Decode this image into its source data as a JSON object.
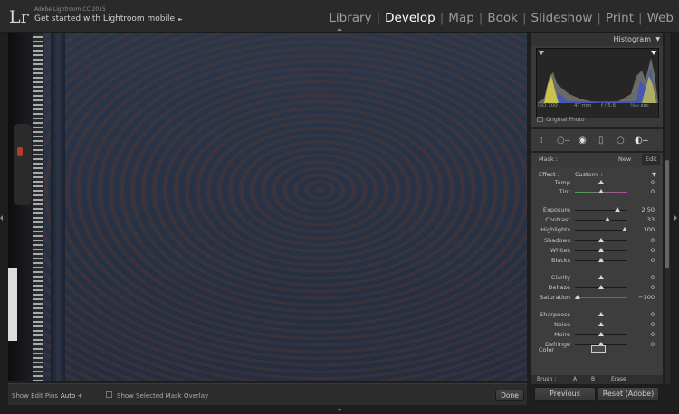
{
  "header": {
    "logo": "Lr",
    "app_name": "Adobe Lightroom CC 2015",
    "mobile_link": "Get started with Lightroom mobile",
    "mobile_arrow": "►",
    "modules": [
      "Library",
      "Develop",
      "Map",
      "Book",
      "Slideshow",
      "Print",
      "Web"
    ],
    "active_module": "Develop",
    "separator": "|"
  },
  "toolbar": {
    "edit_pins_label": "Show Edit Pins :",
    "edit_pins_value": "Auto ÷",
    "mask_overlay_label": "Show Selected Mask Overlay",
    "mask_overlay_checked": false,
    "done_label": "Done"
  },
  "histogram": {
    "title": "Histogram",
    "collapse_icon": "▼",
    "iso": "ISO 100",
    "focal": "47 mm",
    "aperture": "f / 5.6",
    "shutter": "¹⁄₂₀₀ sec",
    "original_photo_label": "Original Photo"
  },
  "tools": [
    "crop-overlay",
    "spot-removal",
    "red-eye",
    "graduated-filter",
    "radial-filter",
    "adjustment-brush"
  ],
  "mask": {
    "label": "Mask :",
    "new_label": "New",
    "edit_label": "Edit"
  },
  "effect": {
    "label": "Effect :",
    "value": "Custom ÷",
    "collapse": "▼"
  },
  "sliders": [
    {
      "label": "Temp",
      "value": "0",
      "position": 0.5
    },
    {
      "label": "Tint",
      "value": "0",
      "position": 0.5
    },
    {
      "label": "Exposure",
      "value": "2.50",
      "position": 0.81
    },
    {
      "label": "Contrast",
      "value": "33",
      "position": 0.62
    },
    {
      "label": "Highlights",
      "value": "100",
      "position": 0.95
    },
    {
      "label": "Shadows",
      "value": "0",
      "position": 0.5
    },
    {
      "label": "Whites",
      "value": "0",
      "position": 0.5
    },
    {
      "label": "Blacks",
      "value": "0",
      "position": 0.5
    },
    {
      "label": "Clarity",
      "value": "0",
      "position": 0.5
    },
    {
      "label": "Dehaze",
      "value": "0",
      "position": 0.5
    },
    {
      "label": "Saturation",
      "value": "−100",
      "position": 0.05
    },
    {
      "label": "Sharpness",
      "value": "0",
      "position": 0.5
    },
    {
      "label": "Noise",
      "value": "0",
      "position": 0.5
    },
    {
      "label": "Moiré",
      "value": "0",
      "position": 0.5
    },
    {
      "label": "Defringe",
      "value": "0",
      "position": 0.5
    }
  ],
  "color_label": "Color",
  "brush": {
    "label": "Brush :",
    "a": "A",
    "b": "B",
    "erase": "Erase"
  },
  "buttons": {
    "previous": "Previous",
    "reset": "Reset (Adobe)"
  },
  "colors": {
    "accent_active": "#ffffff",
    "module_inactive": "#9d9d9d",
    "panel_bg": "#3a3a3a"
  }
}
